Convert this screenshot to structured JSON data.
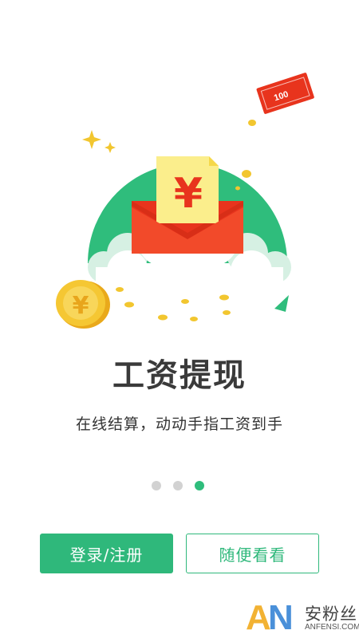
{
  "illustration": {
    "envelope_symbol": "¥",
    "coin_symbol": "¥",
    "bill_value": "100"
  },
  "title": "工资提现",
  "subtitle": "在线结算，动动手指工资到手",
  "pager": {
    "total": 3,
    "active_index": 2
  },
  "buttons": {
    "login_label": "登录/注册",
    "browse_label": "随便看看"
  },
  "watermark": {
    "logo_letters": [
      "A",
      "N"
    ],
    "chinese": "安粉丝",
    "english": "ANFENSI.COM"
  },
  "colors": {
    "accent": "#2fb87b",
    "envelope_red": "#f03c23",
    "card_yellow": "#fbee8c",
    "coin_gold": "#f2c62f"
  }
}
